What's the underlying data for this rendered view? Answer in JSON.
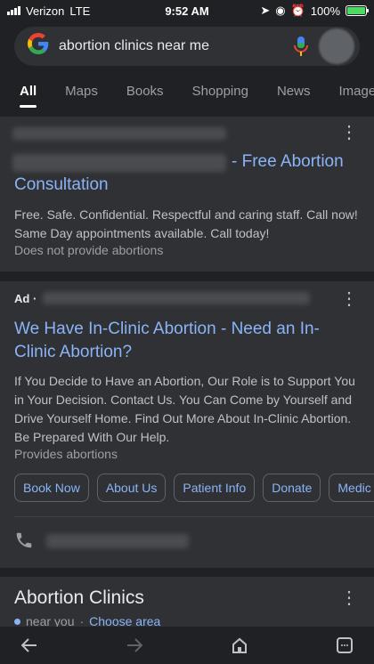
{
  "status": {
    "carrier": "Verizon",
    "network": "LTE",
    "time": "9:52 AM",
    "battery_text": "100%",
    "battery_level": 1.0
  },
  "search": {
    "query": "abortion clinics near me",
    "logo": "G"
  },
  "tabs": [
    "All",
    "Maps",
    "Books",
    "Shopping",
    "News",
    "Images"
  ],
  "result1": {
    "title_suffix": "- Free Abortion",
    "title_line2": "Consultation",
    "description": "Free. Safe. Confidential. Respectful and caring staff. Call now! Same Day appointments available. Call today!",
    "note": "Does not provide abortions"
  },
  "result2": {
    "ad_label": "Ad ·",
    "title": "We Have In-Clinic Abortion - Need an In-Clinic Abortion?",
    "description": "If You Decide to Have an Abortion, Our Role is to Support You in Your Decision. Contact Us. You Can Come by Yourself and Drive Yourself Home. Find Out More About In-Clinic Abortion. Be Prepared With Our Help.",
    "note": "Provides abortions",
    "chips": [
      "Book Now",
      "About Us",
      "Patient Info",
      "Donate",
      "Medic"
    ]
  },
  "clinics": {
    "heading": "Abortion Clinics",
    "near_you": "near you",
    "choose_area": "Choose area"
  },
  "colors": {
    "link": "#8ab4f8",
    "card": "#303134",
    "background": "#202124"
  }
}
